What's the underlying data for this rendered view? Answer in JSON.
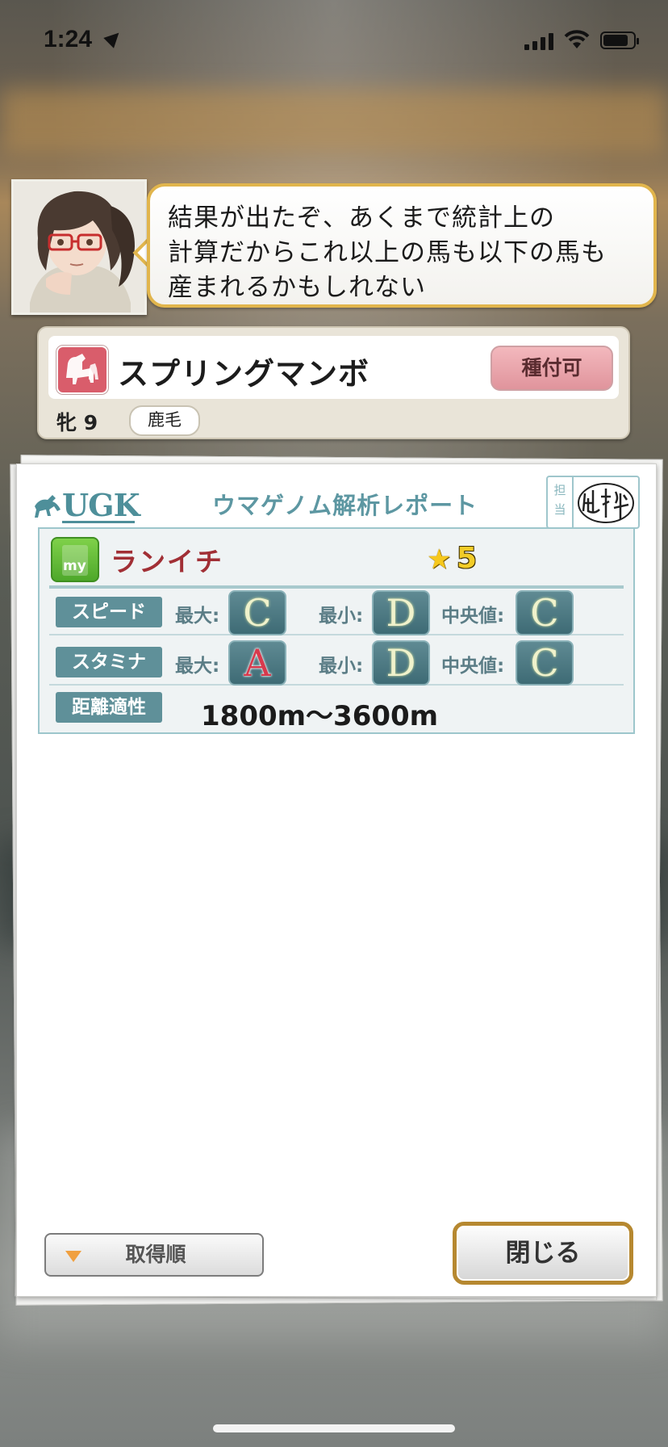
{
  "status_bar": {
    "time": "1:24"
  },
  "dialog": {
    "message_lines": [
      "結果が出たぞ、あくまで統計上の",
      "計算だからこれ以上の馬も以下の馬も",
      "産まれるかもしれない"
    ]
  },
  "horse": {
    "name": "スプリングマンボ",
    "breed_button": "種付可",
    "sex_age": "牝 9",
    "coat": "鹿毛"
  },
  "report": {
    "logo": "UGK",
    "title": "ウマゲノム解析レポート",
    "stamp_label": "担当",
    "stamp_signature": "山科",
    "icon_text": "my",
    "gene_name": "ランイチ",
    "star_icon": "★",
    "rank": "5",
    "speed": {
      "label": "スピード",
      "max_label": "最大:",
      "max": "C",
      "min_label": "最小:",
      "min": "D",
      "median_label": "中央値:",
      "median": "C"
    },
    "stamina": {
      "label": "スタミナ",
      "max_label": "最大:",
      "max": "A",
      "min_label": "最小:",
      "min": "D",
      "median_label": "中央値:",
      "median": "C"
    },
    "distance": {
      "label": "距離適性",
      "value": "1800m〜3600m"
    }
  },
  "buttons": {
    "sort": "取得順",
    "close": "閉じる"
  },
  "colors": {
    "accent_teal": "#5f9099",
    "bubble_border": "#e1b54c",
    "breed_button": "#e0949c",
    "gene_name": "#a12f35",
    "close_border": "#b68830"
  }
}
